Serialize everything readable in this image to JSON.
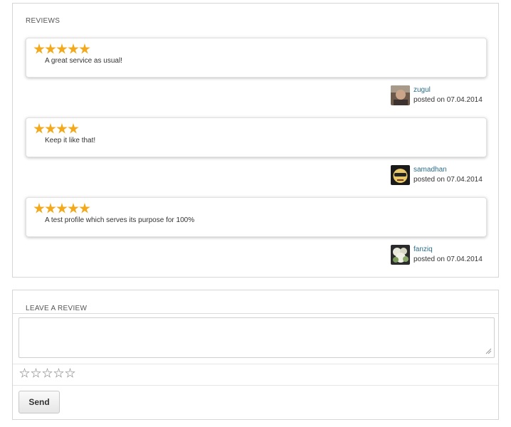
{
  "reviews": {
    "title": "REVIEWS",
    "items": [
      {
        "rating": 5,
        "text": "A great service as usual!",
        "author": "zugul",
        "posted": "posted on 07.04.2014",
        "avatar_icon": "user-avatar-photo"
      },
      {
        "rating": 4,
        "text": "Keep it like that!",
        "author": "samadhan",
        "posted": "posted on 07.04.2014",
        "avatar_icon": "user-avatar-cartoon-face"
      },
      {
        "rating": 5,
        "text": "A test profile which serves its purpose for 100%",
        "author": "fanziq",
        "posted": "posted on 07.04.2014",
        "avatar_icon": "user-avatar-flowers"
      }
    ]
  },
  "leave_review": {
    "title": "LEAVE A REVIEW",
    "textarea_value": "",
    "rating_max": 5,
    "rating_value": 0,
    "send_label": "Send"
  },
  "colors": {
    "star_filled": "#f2a91b",
    "author_link": "#2a6e8c",
    "border": "#d6d6d6"
  }
}
